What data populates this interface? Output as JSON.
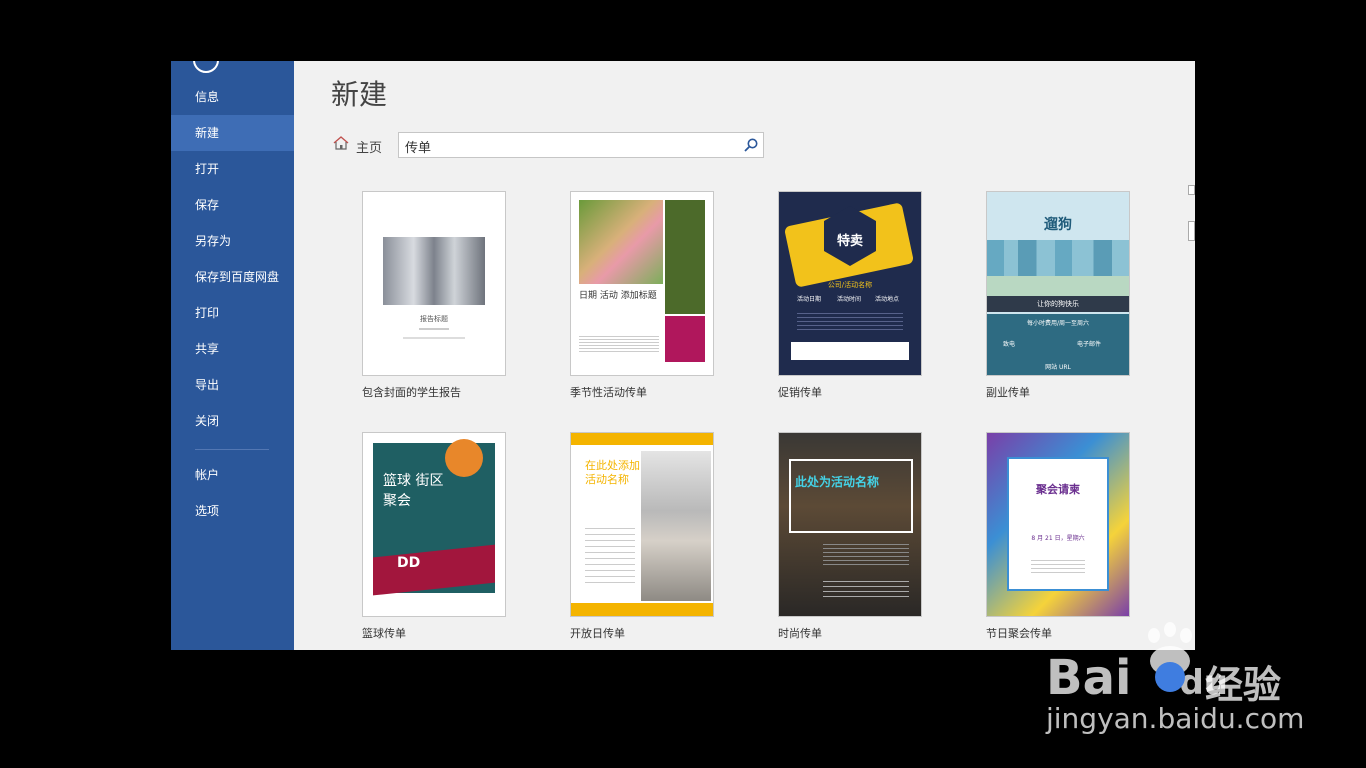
{
  "sidebar": {
    "items": [
      "信息",
      "新建",
      "打开",
      "保存",
      "另存为",
      "保存到百度网盘",
      "打印",
      "共享",
      "导出",
      "关闭"
    ],
    "bottom_items": [
      "帐户",
      "选项"
    ],
    "active_index": 1
  },
  "main": {
    "title": "新建",
    "home_label": "主页",
    "search_value": "传单"
  },
  "templates": [
    {
      "label": "包含封面的学生报告",
      "thumb_title": "报告标题"
    },
    {
      "label": "季节性活动传单",
      "thumb_title": "日期 活动 添加标题"
    },
    {
      "label": "促销传单",
      "thumb_title": "特卖",
      "thumb_sub": "公司/活动名称",
      "thumb_cols": [
        "活动日期",
        "活动时间",
        "活动地点"
      ]
    },
    {
      "label": "副业传单",
      "thumb_title": "遛狗",
      "thumb_sub": "让你的狗快乐",
      "thumb_line": "每小时费用/周一至周六",
      "thumb_contacts": [
        "致电",
        "电子邮件"
      ],
      "thumb_url": "网站 URL"
    },
    {
      "label": "篮球传单",
      "thumb_title": "篮球 街区 聚会",
      "thumb_dd": "DD"
    },
    {
      "label": "开放日传单",
      "thumb_title": "在此处添加活动名称"
    },
    {
      "label": "时尚传单",
      "thumb_title": "此处为活动名称"
    },
    {
      "label": "节日聚会传单",
      "thumb_title": "聚会请柬",
      "thumb_date": "8 月 21 日，星期六"
    }
  ],
  "watermark": {
    "brand_bai": "Bai",
    "brand_du": "du",
    "brand_cn": "经验",
    "url": "jingyan.baidu.com"
  },
  "colors": {
    "sidebar": "#2b579a",
    "sidebar_active": "#3e6db5",
    "background": "#f1f1f1"
  }
}
